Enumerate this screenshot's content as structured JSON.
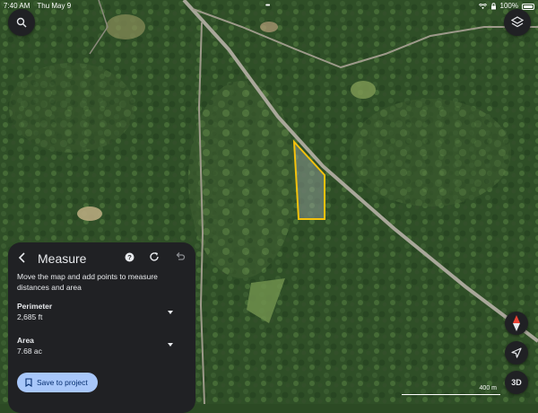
{
  "status_bar": {
    "time": "7:40 AM",
    "date": "Thu May 9",
    "center_dots": "•••",
    "battery": "100%",
    "icons": [
      "wifi-icon",
      "lock-rotation-icon",
      "battery-icon"
    ]
  },
  "top_controls": {
    "search_icon": "search-icon",
    "layers_icon": "layers-icon"
  },
  "measure_panel": {
    "title": "Measure",
    "instruction": "Move the map and add points to measure distances and area",
    "perimeter": {
      "label": "Perimeter",
      "value": "2,685 ft"
    },
    "area": {
      "label": "Area",
      "value": "7.68 ac"
    },
    "save_label": "Save to project",
    "icons": [
      "back-arrow-icon",
      "help-icon",
      "refresh-icon",
      "undo-icon",
      "bookmark-icon",
      "chevron-down-icon"
    ]
  },
  "map_controls": {
    "compass_icon": "compass-icon",
    "location_icon": "location-arrow-icon",
    "view_3d_label": "3D"
  },
  "scale_bar": {
    "label": "400 m"
  },
  "colors": {
    "panel_bg": "#202124",
    "accent": "#a8c7fa",
    "polygon_outline": "#f4c20d",
    "compass_red": "#ea4335"
  }
}
